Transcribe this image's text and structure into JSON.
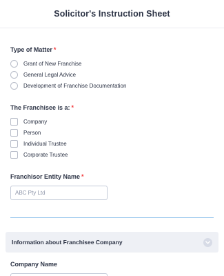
{
  "form": {
    "title": "Solicitor's Instruction Sheet"
  },
  "type_of_matter": {
    "label": "Type of Matter",
    "required_mark": "*",
    "options": [
      "Grant of New Franchise",
      "General Legal Advice",
      "Development of Franchise Documentation"
    ]
  },
  "franchisee_is": {
    "label": "The Franchisee is a:",
    "required_mark": "*",
    "options": [
      "Company",
      "Person",
      "Individual Trustee",
      "Corporate Trustee"
    ]
  },
  "franchisor_entity": {
    "label": "Franchisor Entity Name",
    "required_mark": "*",
    "placeholder": "ABC Pty Ltd"
  },
  "collapse_section": {
    "title": "Information about Franchisee Company"
  },
  "company_name": {
    "label": "Company Name"
  },
  "colors": {
    "required": "#f23a3c",
    "divider": "#8fc1ec",
    "collapse_bg": "#eef0f5"
  }
}
